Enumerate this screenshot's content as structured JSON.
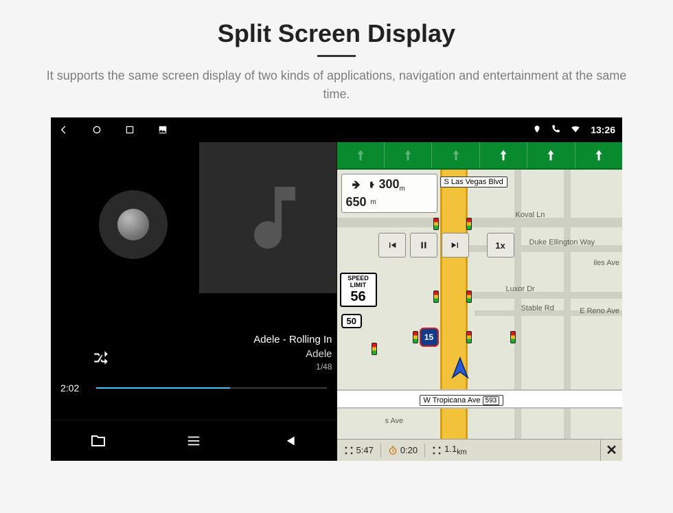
{
  "page": {
    "title": "Split Screen Display",
    "subtitle": "It supports the same screen display of two kinds of applications, navigation and entertainment at the same time."
  },
  "statusbar": {
    "time": "13:26"
  },
  "music": {
    "track_title": "Adele - Rolling In",
    "artist": "Adele",
    "track_index": "1/48",
    "elapsed": "2:02"
  },
  "nav": {
    "turn_now": "650",
    "turn_now_unit": "m",
    "turn_next": "300",
    "turn_next_unit": "m",
    "speed_limit_label": "SPEED\nLIMIT",
    "speed_limit": "56",
    "route_shield": "50",
    "interstate": "15",
    "playback_rate": "1x",
    "street_top": "S Las Vegas Blvd",
    "street_bottom": "W Tropicana Ave",
    "street_bottom_badge": "593",
    "road_koval": "Koval Ln",
    "road_duke": "Duke Ellington Way",
    "road_luxor": "Luxor Dr",
    "road_stable": "Stable Rd",
    "road_reno": "E Reno Ave",
    "road_ali": "iles Ave",
    "road_hays": "s Ave",
    "eta": "5:47",
    "remaining_time": "0:20",
    "remaining_dist": "1.1",
    "remaining_dist_unit": "km"
  }
}
